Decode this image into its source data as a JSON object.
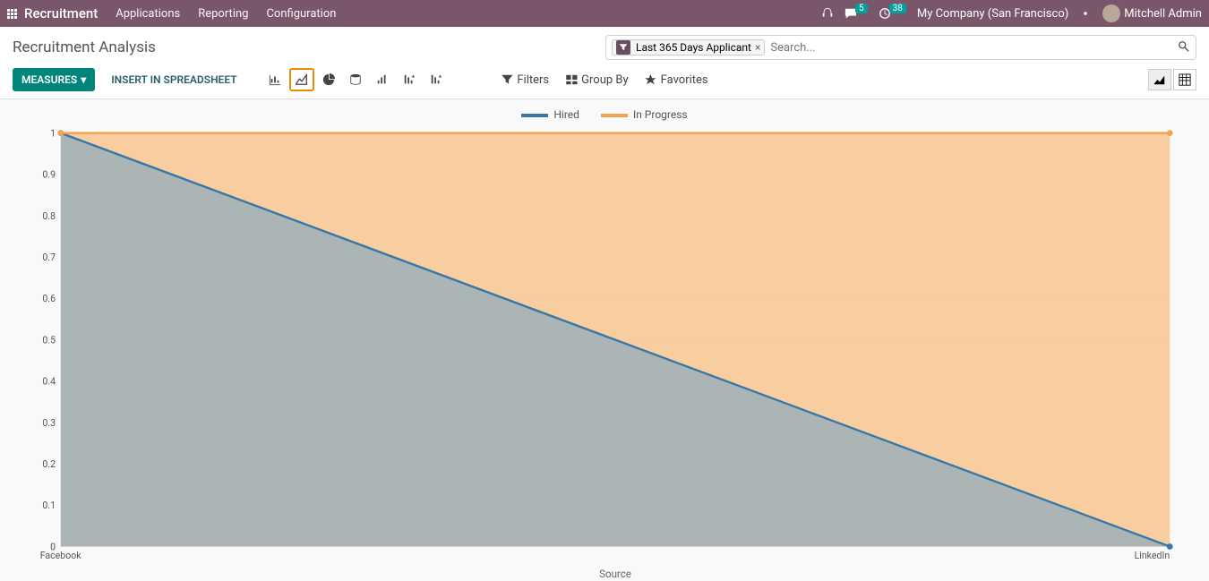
{
  "header": {
    "app": "Recruitment",
    "nav": [
      "Applications",
      "Reporting",
      "Configuration"
    ],
    "company": "My Company (San Francisco)",
    "user": "Mitchell Admin",
    "messages_badge": "5",
    "activities_badge": "38"
  },
  "page": {
    "title": "Recruitment Analysis",
    "filter_chip": "Last 365 Days Applicant",
    "search_placeholder": "Search...",
    "measures_label": "Measures",
    "insert_label": "Insert in Spreadsheet",
    "filters_label": "Filters",
    "groupby_label": "Group By",
    "favorites_label": "Favorites"
  },
  "chart_data": {
    "type": "line",
    "title": "",
    "xlabel": "Source",
    "ylabel": "",
    "ylim": [
      0,
      1
    ],
    "yticks": [
      0,
      0.1,
      0.2,
      0.3,
      0.4,
      0.5,
      0.6,
      0.7,
      0.8,
      0.9,
      1
    ],
    "categories": [
      "Facebook",
      "LinkedIn"
    ],
    "series": [
      {
        "name": "Hired",
        "color": "#3878a8",
        "values": [
          1,
          0
        ]
      },
      {
        "name": "In Progress",
        "color": "#f5a24e",
        "values": [
          1,
          1
        ]
      }
    ],
    "area_fill": true
  }
}
